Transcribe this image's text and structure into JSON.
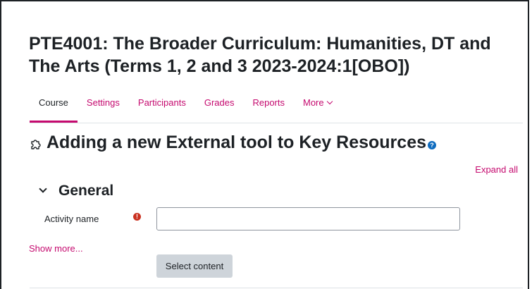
{
  "course": {
    "title": "PTE4001: The Broader Curriculum: Humanities, DT and The Arts (Terms 1, 2 and 3 2023-2024:1[OBO])"
  },
  "nav": {
    "items": [
      {
        "label": "Course",
        "active": true
      },
      {
        "label": "Settings"
      },
      {
        "label": "Participants"
      },
      {
        "label": "Grades"
      },
      {
        "label": "Reports"
      },
      {
        "label": "More"
      }
    ]
  },
  "page": {
    "heading": "Adding a new External tool to Key Resources",
    "heading_icon": "puzzle-piece-icon",
    "help_icon_glyph": "?",
    "expand_all": "Expand all"
  },
  "general": {
    "title": "General",
    "activity_name_label": "Activity name",
    "activity_name_value": "",
    "activity_name_placeholder": "",
    "required_icon_glyph": "!",
    "show_more": "Show more...",
    "select_content_label": "Select content"
  },
  "colors": {
    "brand": "#c50a6f",
    "help": "#0f6cbf",
    "required": "#ca3120",
    "button_bg": "#ced4da"
  }
}
